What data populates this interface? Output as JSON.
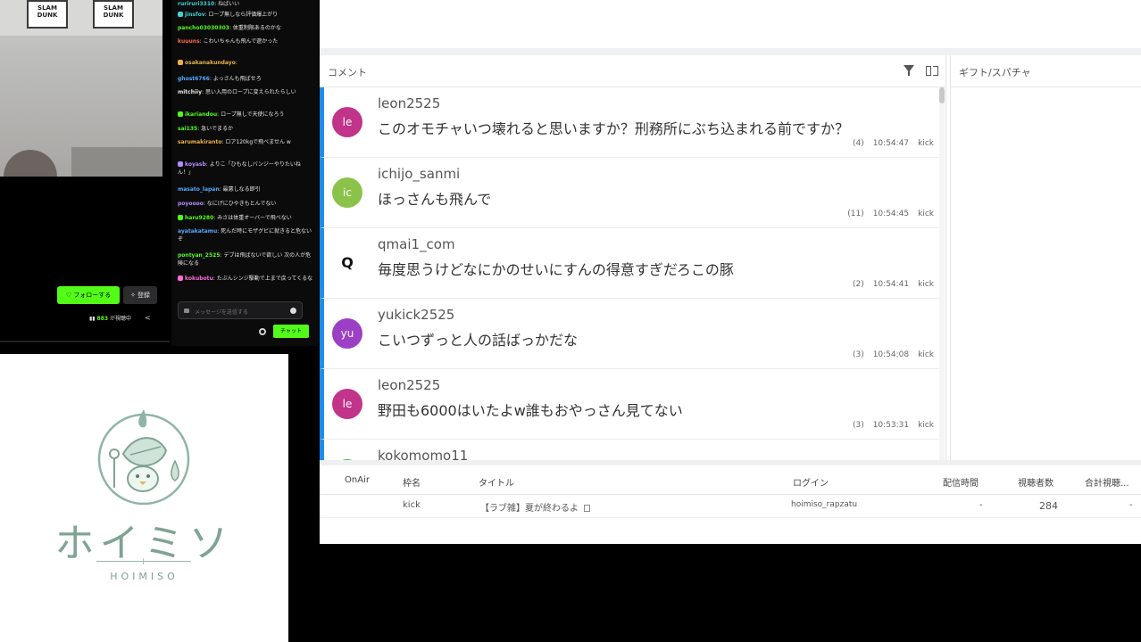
{
  "webcam": {
    "poster_text": [
      "SLAM DUNK",
      "SLAM DUNK"
    ]
  },
  "kick_chat": {
    "messages": [
      {
        "user": "ruriruri3310",
        "text": "ねばいい",
        "color": "#3fd0d0"
      },
      {
        "user": "jinsfov",
        "text": "ロープ無しなら評価爆上がり",
        "color": "#3fd0d0"
      },
      {
        "user": "pancho03030303",
        "text": "体重制限あるのかな",
        "color": "#53fc18"
      },
      {
        "user": "kuuuns",
        "text": "こわいちゃんも飛んで遊かった",
        "color": "#ff6a3d"
      },
      {
        "user": "osakanakundayo",
        "text": "",
        "color": "#e8b14a"
      },
      {
        "user": "ghost6766",
        "text": "よっさんも飛ばせろ",
        "color": "#53a8ff"
      },
      {
        "user": "mitchiiy",
        "text": "思い入用のロープに変えられたらしい",
        "color": "#e6e6e6"
      },
      {
        "user": "ikariandou",
        "text": "ロープ無しで天使になろう",
        "color": "#53fc18"
      },
      {
        "user": "sai135",
        "text": "急いでまるか",
        "color": "#53fc18"
      },
      {
        "user": "sarumakiranto",
        "text": "ロア120kgで飛べません w",
        "color": "#e8b14a"
      },
      {
        "user": "koyasb",
        "text": "よりこ「ひもなしバンジーやりたいねん！」",
        "color": "#b58cff"
      },
      {
        "user": "masato_lapan",
        "text": "最悪しなる即引",
        "color": "#53a8ff"
      },
      {
        "user": "poyoooo",
        "text": "なにげにひやきもとんでない",
        "color": "#b58cff"
      },
      {
        "user": "haru9280",
        "text": "みさは体重オーバーで飛べない",
        "color": "#53fc18"
      },
      {
        "user": "ayatakatamu",
        "text": "死んだ時にモザグビに就きると危ないぞ",
        "color": "#53a8ff"
      },
      {
        "user": "pontyan_2525",
        "text": "デブは飛ばないで欲しい 次の人が危険になる",
        "color": "#53fc18"
      },
      {
        "user": "kokubotu",
        "text": "たぶんシンジ駆動で上まで戻ってくるな",
        "color": "#ff6ad5"
      }
    ],
    "input_placeholder": "メッセージを送信する",
    "send_label": "チャット"
  },
  "player": {
    "follow_label": "♡ フォローする",
    "subscribe_label": "✧ 登録",
    "viewer_count": "883",
    "viewer_suffix": "が視聴中"
  },
  "logo": {
    "name": "ホイミソ",
    "subtitle": "HOIMISO",
    "brand_color": "#7fa394"
  },
  "comment_viewer": {
    "comments_title": "コメント",
    "gifts_title": "ギフト/スパチャ",
    "accent_color": "#1f8ceb",
    "comments": [
      {
        "avatar": "le",
        "avatar_color": "#c2338a",
        "user": "leon2525",
        "text": "このオモチャいつ壊れると思いますか？刑務所にぶち込まれる前ですか？",
        "count": "(4)",
        "time": "10:54:47",
        "source": "kick"
      },
      {
        "avatar": "ic",
        "avatar_color": "#8bc34a",
        "user": "ichijo_sanmi",
        "text": "ほっさんも飛んで",
        "count": "(11)",
        "time": "10:54:45",
        "source": "kick"
      },
      {
        "avatar": "Q",
        "avatar_color": "#ffffff",
        "user": "qmai1_com",
        "text": "毎度思うけどなにかのせいにすんの得意すぎだろこの豚",
        "count": "(2)",
        "time": "10:54:41",
        "source": "kick"
      },
      {
        "avatar": "yu",
        "avatar_color": "#9c3fc4",
        "user": "yukick2525",
        "text": "こいつずっと人の話ばっかだな",
        "count": "(3)",
        "time": "10:54:08",
        "source": "kick"
      },
      {
        "avatar": "le",
        "avatar_color": "#c2338a",
        "user": "leon2525",
        "text": "野田も6000はいたよw誰もおやっさん見てない",
        "count": "(3)",
        "time": "10:53:31",
        "source": "kick"
      },
      {
        "avatar": "ko",
        "avatar_color": "#4caf50",
        "user": "kokomomo11",
        "text": "",
        "count": "",
        "time": "",
        "source": ""
      }
    ],
    "table": {
      "headers": [
        "OnAir",
        "枠名",
        "タイトル",
        "ログイン",
        "配信時間",
        "視聴者数",
        "合計視聴..."
      ],
      "rows": [
        {
          "onair": "",
          "frame": "kick",
          "title": "【ラブ雑】夏が終わるよ",
          "login": "hoimiso_rapzatu",
          "duration": "-",
          "viewers": "284",
          "total": "-"
        }
      ]
    }
  }
}
